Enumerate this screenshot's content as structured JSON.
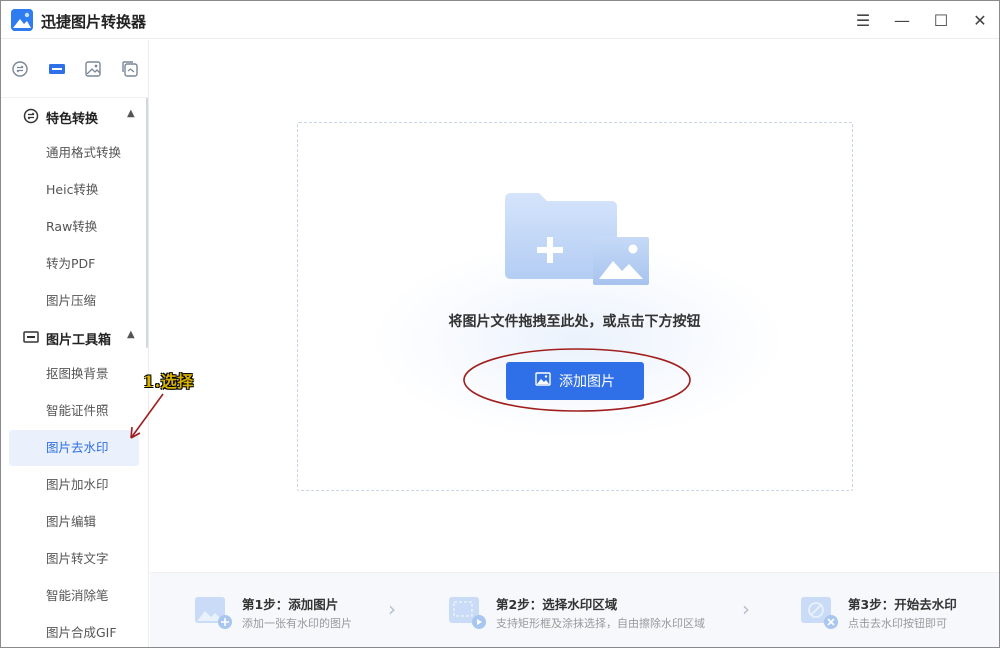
{
  "app": {
    "title": "迅捷图片转换器"
  },
  "window_controls": {
    "menu": "☰",
    "minimize": "—",
    "maximize": "☐",
    "close": "✕"
  },
  "sidebar": {
    "top_icons": [
      "convert-icon",
      "toolbox-icon",
      "image-icon",
      "batch-icon"
    ],
    "groups": [
      {
        "label": "特色转换",
        "expanded": true,
        "items": [
          "通用格式转换",
          "Heic转换",
          "Raw转换",
          "转为PDF",
          "图片压缩"
        ]
      },
      {
        "label": "图片工具箱",
        "expanded": true,
        "items": [
          "抠图换背景",
          "智能证件照",
          "图片去水印",
          "图片加水印",
          "图片编辑",
          "图片转文字",
          "智能消除笔",
          "图片合成GIF"
        ]
      }
    ],
    "active_item": "图片去水印"
  },
  "main": {
    "drop_text": "将图片文件拖拽至此处，或点击下方按钮",
    "add_button": "添加图片"
  },
  "steps": [
    {
      "title": "第1步：添加图片",
      "desc": "添加一张有水印的图片"
    },
    {
      "title": "第2步：选择水印区域",
      "desc": "支持矩形框及涂抹选择，自由擦除水印区域"
    },
    {
      "title": "第3步：开始去水印",
      "desc": "点击去水印按钮即可"
    }
  ],
  "annotation": {
    "label": "1.选择"
  },
  "colors": {
    "accent": "#2f6fe8",
    "active_bg": "#eaf1fd",
    "annotation_red": "#a01e1e",
    "annotation_text": "#d8b200"
  }
}
